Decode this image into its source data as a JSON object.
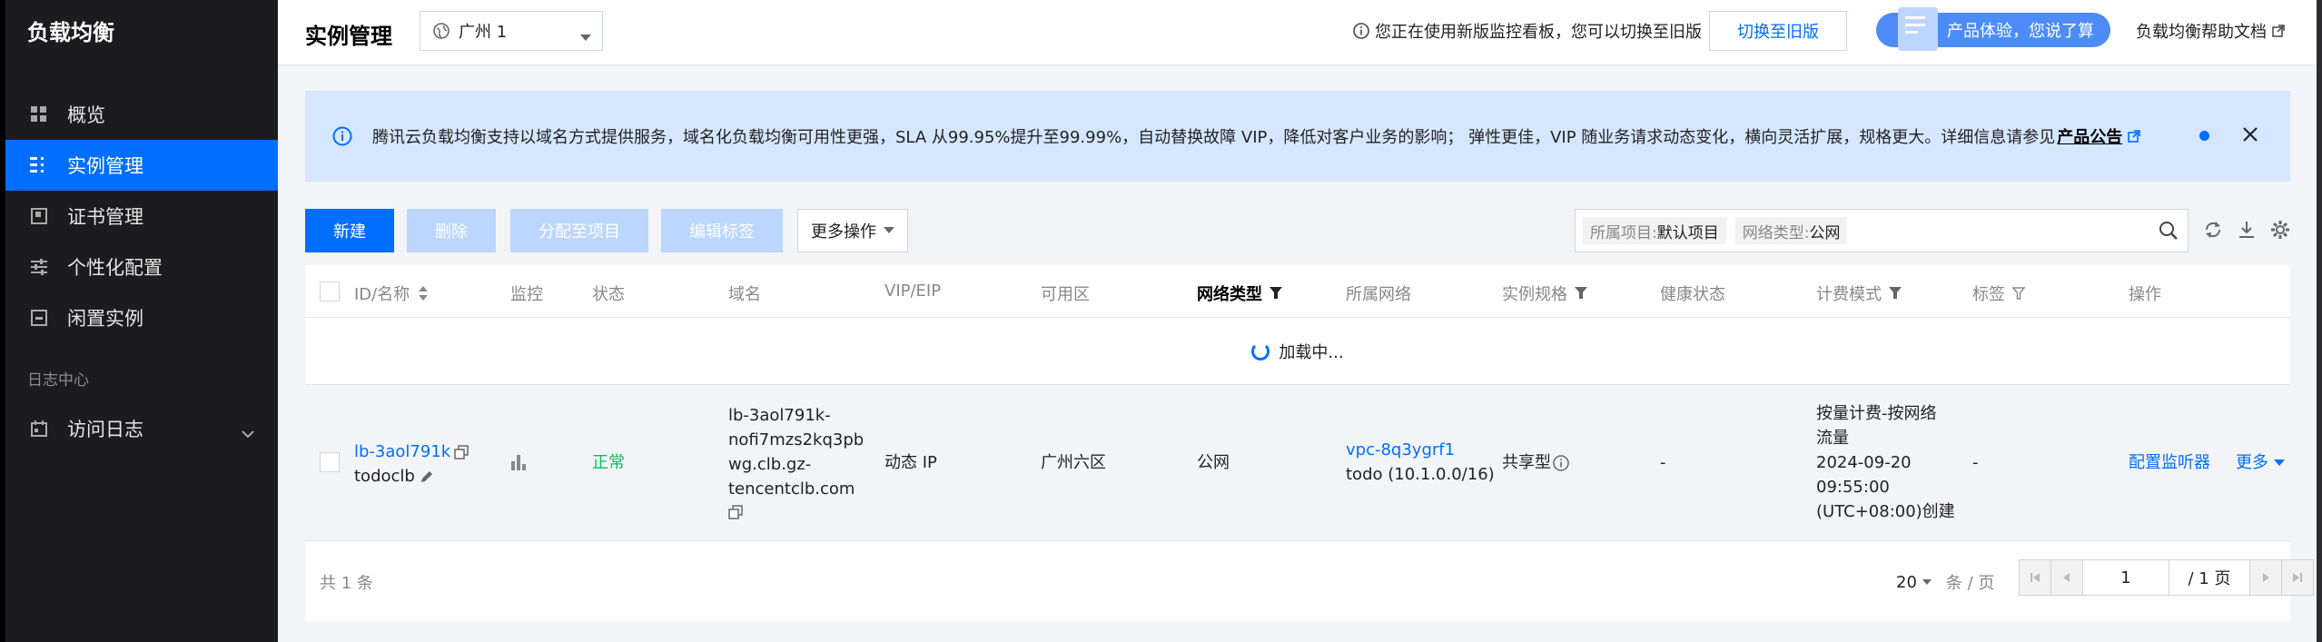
{
  "sidebar": {
    "title": "负载均衡",
    "items": [
      {
        "label": "概览",
        "icon": "grid-icon"
      },
      {
        "label": "实例管理",
        "icon": "list-icon"
      },
      {
        "label": "证书管理",
        "icon": "certificate-icon"
      },
      {
        "label": "个性化配置",
        "icon": "sliders-icon"
      },
      {
        "label": "闲置实例",
        "icon": "archive-icon"
      }
    ],
    "group_label": "日志中心",
    "log_item": {
      "label": "访问日志",
      "icon": "calendar-icon"
    }
  },
  "header": {
    "title": "实例管理",
    "region": "广州 1",
    "notice": "您正在使用新版监控看板，您可以切换至旧版",
    "switch_old_label": "切换至旧版",
    "experience_label": "产品体验，您说了算",
    "help_label": "负载均衡帮助文档"
  },
  "alert": {
    "text": "腾讯云负载均衡支持以域名方式提供服务，域名化负载均衡可用性更强，SLA 从99.95%提升至99.99%，自动替换故障 VIP，降低对客户业务的影响； 弹性更佳，VIP 随业务请求动态变化，横向灵活扩展，规格更大。详细信息请参见",
    "link_label": "产品公告"
  },
  "toolbar": {
    "new_label": "新建",
    "delete_label": "删除",
    "assign_label": "分配至项目",
    "edit_tags_label": "编辑标签",
    "more_label": "更多操作",
    "filter_project_key": "所属项目:",
    "filter_project_value": "默认项目",
    "filter_network_key": "网络类型:",
    "filter_network_value": "公网"
  },
  "table": {
    "columns": [
      "ID/名称",
      "监控",
      "状态",
      "域名",
      "VIP/EIP",
      "可用区",
      "网络类型",
      "所属网络",
      "实例规格",
      "健康状态",
      "计费模式",
      "标签",
      "操作"
    ],
    "loading_text": "加载中...",
    "row": {
      "id": "lb-3aol791k",
      "name": "todoclb",
      "status": "正常",
      "domain_lines": [
        "lb-3aol791k-",
        "nofi7mzs2kq3pb",
        "wg.clb.gz-",
        "tencentclb.com"
      ],
      "vip": "动态 IP",
      "zone": "广州六区",
      "network_type": "公网",
      "vpc_id": "vpc-8q3ygrf1",
      "vpc_name": "todo (10.1.0.0/16)",
      "spec": "共享型",
      "health": "-",
      "billing_lines": [
        "按量计费-按网络",
        "流量",
        "2024-09-20",
        "09:55:00",
        "(UTC+08:00)创建"
      ],
      "tags": "-",
      "action_config": "配置监听器",
      "action_more": "更多"
    },
    "footer": {
      "total": "共 1 条",
      "page_size": "20",
      "page_size_unit": "条 / 页",
      "page_current": "1",
      "page_total": "/ 1 页"
    }
  },
  "colors": {
    "accent": "#006eff",
    "sidebar_bg": "#1c1c1f",
    "alert_bg": "#d5e7ff",
    "status_ok": "#0abf5b"
  }
}
